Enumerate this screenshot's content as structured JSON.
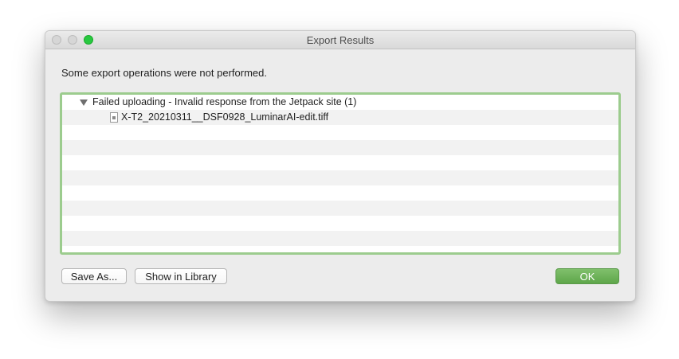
{
  "window": {
    "title": "Export Results"
  },
  "message": "Some export operations were not performed.",
  "results": {
    "group_label": "Failed uploading - Invalid response from the Jetpack site (1)",
    "file_name": "X-T2_20210311__DSF0928_LuminarAI-edit.tiff"
  },
  "buttons": {
    "save_as": "Save As...",
    "show_in_library": "Show in Library",
    "ok": "OK"
  },
  "colors": {
    "ok_button": "#6cb058",
    "list_focus_ring": "#9ccc8e",
    "zoom_button": "#28c840"
  }
}
